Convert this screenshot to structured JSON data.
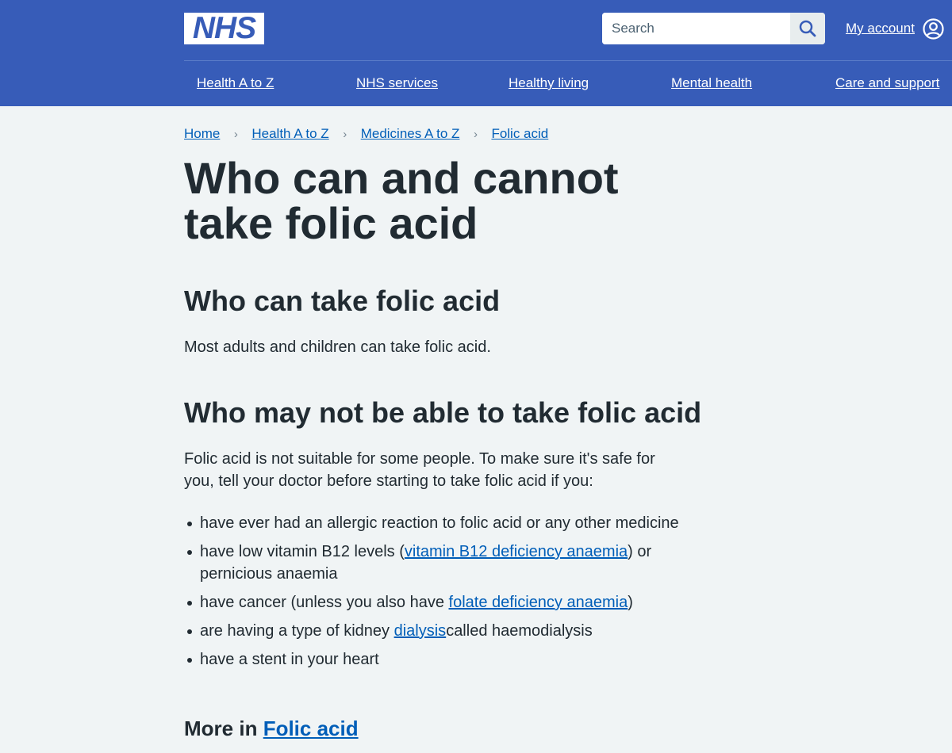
{
  "header": {
    "logo_text": "NHS",
    "search_placeholder": "Search",
    "account_label": "My account",
    "brand_color": "#375cb8"
  },
  "nav": {
    "items": [
      {
        "label": "Health A to Z"
      },
      {
        "label": "NHS services"
      },
      {
        "label": "Healthy living"
      },
      {
        "label": "Mental health"
      },
      {
        "label": "Care and support"
      }
    ]
  },
  "breadcrumb": {
    "items": [
      {
        "label": "Home"
      },
      {
        "label": "Health A to Z"
      },
      {
        "label": "Medicines A to Z"
      },
      {
        "label": "Folic acid"
      }
    ]
  },
  "main": {
    "title": "Who can and cannot take folic acid",
    "section1": {
      "heading": "Who can take folic acid",
      "text": "Most adults and children can take folic acid."
    },
    "section2": {
      "heading": "Who may not be able to take folic acid",
      "intro": "Folic acid is not suitable for some people. To make sure it's safe for you, tell your doctor before starting to take folic acid if you:",
      "bullets": [
        {
          "text": "have ever had an allergic reaction to folic acid or any other medicine"
        },
        {
          "before": "have low vitamin B12 levels (",
          "link": "vitamin B12 deficiency anaemia",
          "after": ") or pernicious anaemia"
        },
        {
          "before": "have cancer (unless you also have ",
          "link": "folate deficiency anaemia",
          "after": ")"
        },
        {
          "before": "are having a type of kidney ",
          "link": "dialysis",
          "after": "called haemodialysis"
        },
        {
          "text": "have a stent in your heart"
        }
      ]
    },
    "more_in": {
      "prefix": "More in",
      "link": "Folic acid"
    }
  }
}
